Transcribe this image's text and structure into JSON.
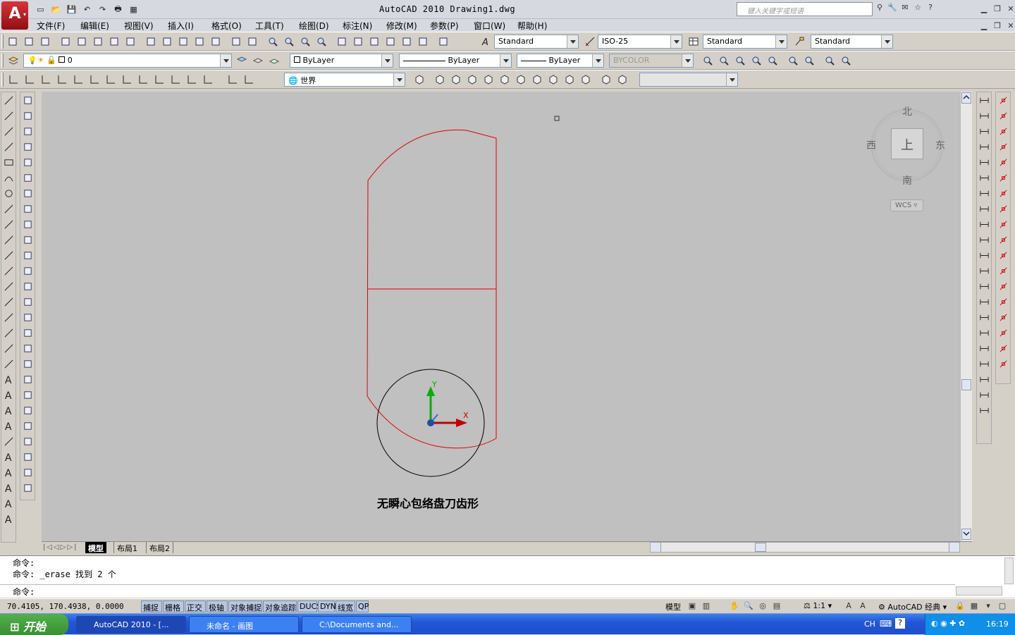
{
  "window": {
    "title": "AutoCAD 2010  Drawing1.dwg",
    "search_placeholder": "键入关键字或短语"
  },
  "menu": [
    "文件(F)",
    "编辑(E)",
    "视图(V)",
    "插入(I)",
    "格式(O)",
    "工具(T)",
    "绘图(D)",
    "标注(N)",
    "修改(M)",
    "参数(P)",
    "窗口(W)",
    "帮助(H)"
  ],
  "styles_toolbar": {
    "text_style": "Standard",
    "dim_style": "ISO-25",
    "table_style": "Standard",
    "multileader_style": "Standard"
  },
  "layers_toolbar": {
    "current_layer": "0"
  },
  "properties_toolbar": {
    "color": "ByLayer",
    "linetype": "ByLayer",
    "lineweight": "ByLayer",
    "plotstyle": "BYCOLOR"
  },
  "ucs_toolbar": {
    "ucs_name": "世界"
  },
  "viewcube": {
    "north": "北",
    "south": "南",
    "east": "东",
    "west": "西",
    "face": "上",
    "wcs_label": "WCS"
  },
  "drawing": {
    "caption": "无瞬心包络盘刀齿形",
    "ucs_x": "X",
    "ucs_y": "Y",
    "colors": {
      "profile": "#e00000",
      "circle": "#000000",
      "canvas": "#c0c0c0"
    }
  },
  "layout_tabs": [
    "模型",
    "布局1",
    "布局2"
  ],
  "command": {
    "history": [
      "命令:",
      "命令: _erase 找到 2 个"
    ],
    "prompt": "命令:"
  },
  "status": {
    "coordinates": "70.4105,  170.4938, 0.0000",
    "toggles": [
      "捕捉",
      "栅格",
      "正交",
      "极轴",
      "对象捕捉",
      "对象追踪",
      "DUCS",
      "DYN",
      "线宽",
      "QP"
    ],
    "model_label": "模型",
    "annotation_scale": "1:1",
    "workspace": "AutoCAD 经典"
  },
  "taskbar": {
    "start": "开始",
    "tasks": [
      "AutoCAD 2010 - [...",
      "未命名 - 画图",
      "C:\\Documents and..."
    ],
    "lang": "CH",
    "time": "16:19"
  }
}
